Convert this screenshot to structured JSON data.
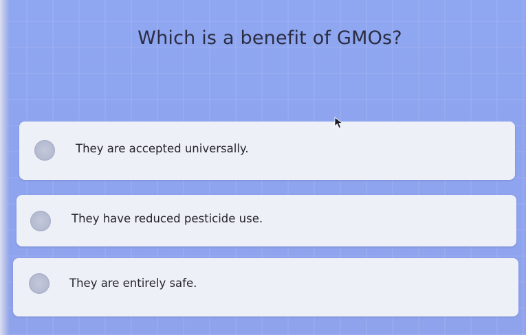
{
  "question": {
    "text": "Which is a benefit of GMOs?"
  },
  "options": [
    {
      "label": "They are accepted universally.",
      "selected": false
    },
    {
      "label": "They have reduced pesticide use.",
      "selected": false
    },
    {
      "label": "They are entirely safe.",
      "selected": false
    }
  ],
  "icons": {
    "cursor": "mouse-pointer-icon",
    "radio": "radio-button-icon"
  },
  "colors": {
    "background": "#8fa6f0",
    "option_background": "#eef0f8",
    "radio_fill": "#b9bfd4",
    "text": "#23242c"
  }
}
